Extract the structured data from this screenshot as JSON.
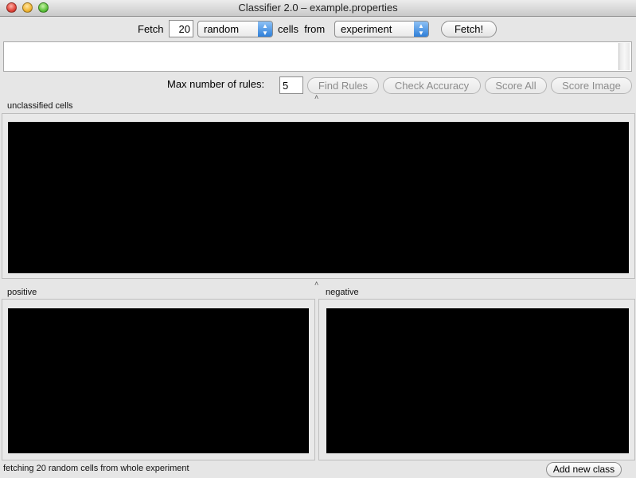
{
  "window": {
    "title": "Classifier 2.0 – example.properties"
  },
  "fetch": {
    "label": "Fetch",
    "count": "20",
    "mode": "random",
    "cells_from_label": "cells  from",
    "source": "experiment",
    "fetch_button": "Fetch!"
  },
  "rules": {
    "max_label": "Max number of rules:",
    "max_value": "5",
    "find_rules": "Find Rules",
    "check_accuracy": "Check Accuracy",
    "score_all": "Score All",
    "score_image": "Score Image"
  },
  "sections": {
    "unclassified": "unclassified cells",
    "positive": "positive",
    "negative": "negative"
  },
  "status": {
    "text": "fetching 20 random cells from whole experiment",
    "add_class": "Add new class"
  }
}
